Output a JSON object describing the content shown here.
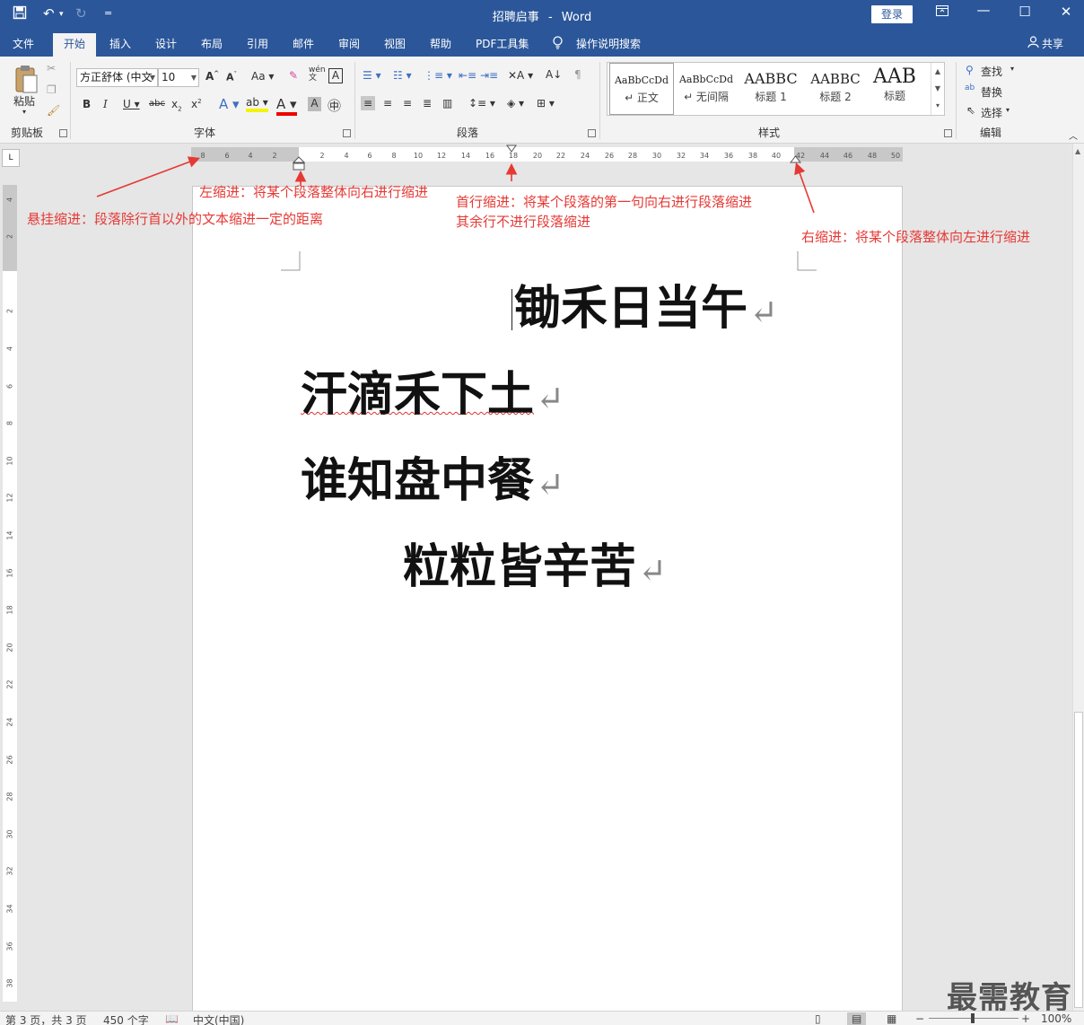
{
  "title_bar": {
    "doc_name": "招聘启事",
    "separator": "-",
    "app_name": "Word",
    "login": "登录",
    "qa_more": "="
  },
  "tabs": [
    "文件",
    "开始",
    "插入",
    "设计",
    "布局",
    "引用",
    "邮件",
    "审阅",
    "视图",
    "帮助",
    "PDF工具集"
  ],
  "tell_me": "操作说明搜索",
  "share": "共享",
  "ribbon": {
    "clipboard": {
      "paste": "粘贴",
      "label": "剪贴板"
    },
    "font": {
      "font_name": "方正舒体 (中文",
      "font_size": "10",
      "label": "字体"
    },
    "paragraph": {
      "label": "段落"
    },
    "styles": {
      "label": "样式",
      "items": [
        {
          "preview": "AaBbCcDd",
          "name": "↵ 正文"
        },
        {
          "preview": "AaBbCcDd",
          "name": "↵ 无间隔"
        },
        {
          "preview": "AABBC",
          "name": "标题 1"
        },
        {
          "preview": "AABBC",
          "name": "标题 2"
        },
        {
          "preview": "AAB",
          "name": "标题"
        }
      ]
    },
    "editing": {
      "find": "查找",
      "replace": "替换",
      "select": "选择",
      "label": "编辑"
    }
  },
  "ruler": {
    "left_ticks": [
      "8",
      "6",
      "4",
      "2"
    ],
    "ticks": [
      "2",
      "4",
      "6",
      "8",
      "10",
      "12",
      "14",
      "16",
      "18",
      "20",
      "22",
      "24",
      "26",
      "28",
      "30",
      "32",
      "34",
      "36",
      "38",
      "40",
      "42",
      "44",
      "46",
      "48",
      "50"
    ],
    "vertical_ticks": [
      "4",
      "2",
      "2",
      "4",
      "6",
      "8",
      "10",
      "12",
      "14",
      "16",
      "18",
      "20",
      "22",
      "24",
      "26",
      "28",
      "30",
      "32",
      "34",
      "36",
      "38"
    ]
  },
  "annotations": {
    "left_indent": "左缩进：将某个段落整体向右进行缩进",
    "hanging_indent": "悬挂缩进：段落除行首以外的文本缩进一定的距离",
    "first_line_1": "首行缩进：将某个段落的第一句向右进行段落缩进",
    "first_line_2": "其余行不进行段落缩进",
    "right_indent": "右缩进：将某个段落整体向左进行缩进"
  },
  "document": {
    "lines": [
      "锄禾日当午",
      "汗滴禾下土",
      "谁知盘中餐",
      "粒粒皆辛苦"
    ],
    "paragraph_mark": "↵"
  },
  "status": {
    "page": "第 3 页，共 3 页",
    "words": "450 个字",
    "lang": "中文(中国)",
    "zoom": "100%"
  },
  "watermark": "最需教育",
  "colors": {
    "title_blue": "#2b579a",
    "annotation_red": "#e53935"
  }
}
